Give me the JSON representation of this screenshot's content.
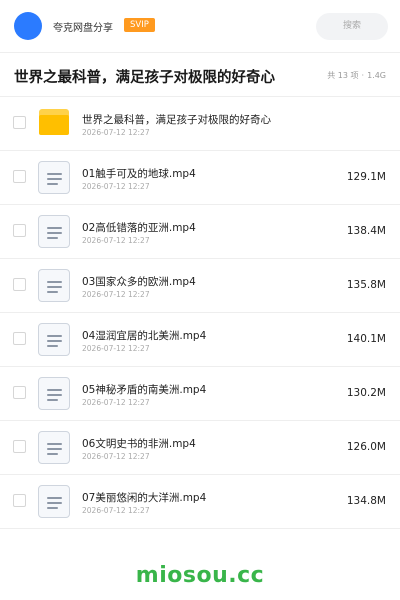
{
  "header": {
    "site_name": "夸克网盘分享",
    "badge": "SVIP",
    "search_placeholder": "搜索"
  },
  "share": {
    "title": "世界之最科普，满足孩子对极限的好奇心",
    "item_count": "共 13 项",
    "separator": "·",
    "total_size": "1.4G"
  },
  "files": [
    {
      "name": "世界之最科普，满足孩子对极限的好奇心",
      "date": "2026-07-12 12:27",
      "size": "",
      "type": "folder"
    },
    {
      "name": "01触手可及的地球.mp4",
      "date": "2026-07-12 12:27",
      "size": "129.1M",
      "type": "file"
    },
    {
      "name": "02高低错落的亚洲.mp4",
      "date": "2026-07-12 12:27",
      "size": "138.4M",
      "type": "file"
    },
    {
      "name": "03国家众多的欧洲.mp4",
      "date": "2026-07-12 12:27",
      "size": "135.8M",
      "type": "file"
    },
    {
      "name": "04湿润宜居的北美洲.mp4",
      "date": "2026-07-12 12:27",
      "size": "140.1M",
      "type": "file"
    },
    {
      "name": "05神秘矛盾的南美洲.mp4",
      "date": "2026-07-12 12:27",
      "size": "130.2M",
      "type": "file"
    },
    {
      "name": "06文明史书的非洲.mp4",
      "date": "2026-07-12 12:27",
      "size": "126.0M",
      "type": "file"
    },
    {
      "name": "07美丽悠闲的大洋洲.mp4",
      "date": "2026-07-12 12:27",
      "size": "134.8M",
      "type": "file"
    }
  ],
  "watermark": "miosou.cc",
  "colors": {
    "avatar": "#2b7bff",
    "badge": "#ff9a1f",
    "folder": "#ffbf00",
    "watermark": "#39b54a"
  }
}
